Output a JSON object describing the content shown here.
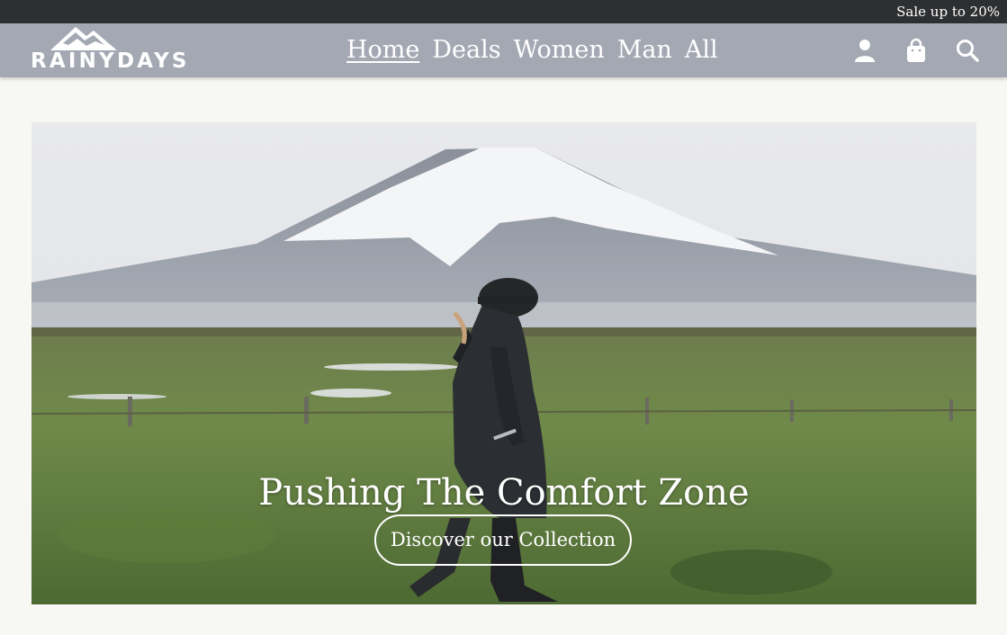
{
  "topbar": {
    "sale_text": "Sale up to 20%"
  },
  "logo": {
    "text": "RAINYDAYS"
  },
  "nav": {
    "items": [
      {
        "label": "Home",
        "active": true
      },
      {
        "label": "Deals"
      },
      {
        "label": "Women"
      },
      {
        "label": "Man"
      },
      {
        "label": "All"
      }
    ]
  },
  "icons": {
    "user": "user-icon",
    "bag": "shopping-bag-icon",
    "search": "search-icon"
  },
  "hero": {
    "headline": "Pushing The Comfort Zone",
    "cta_label": "Discover our Collection"
  },
  "colors": {
    "topbar_bg": "#2e2f31",
    "navbar_bg": "#a3a8b3",
    "page_bg": "#f7f8f3",
    "text_light": "#ffffff"
  }
}
